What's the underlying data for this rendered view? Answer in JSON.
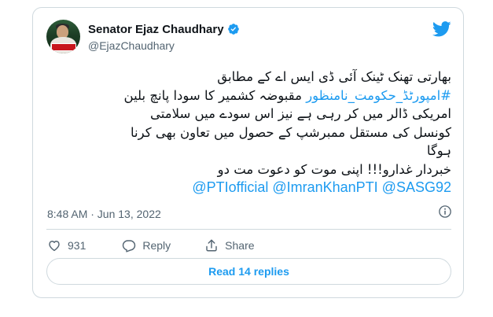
{
  "author": {
    "name": "Senator Ejaz Chaudhary",
    "handle": "@EjazChaudhary"
  },
  "tweet": {
    "lines": [
      "بھارتی تھنک ٹینک آئی ڈی ایس اے کے مطابق",
      "مقبوضہ کشمیر کا سودا پانچ بلین",
      "امریکی ڈالر میں کر رہی ہے نیز اس سودے میں سلامتی",
      "کونسل کی مستقل ممبرشپ کے حصول میں تعاون بھی کرنا",
      "ہوگا",
      "خبردار غدارو!!! اپنی موت کو دعوت مت دو"
    ],
    "hashtag": "#امپورٹڈ_حکومت_نامنظور",
    "mentions": "@PTIofficial @ImranKhanPTI @SASG92"
  },
  "timestamp": "8:48 AM · Jun 13, 2022",
  "actions": {
    "like_count": "931",
    "reply_label": "Reply",
    "share_label": "Share"
  },
  "read_replies_label": "Read 14 replies",
  "colors": {
    "link": "#1d9bf0",
    "text": "#0f1419",
    "muted": "#536471",
    "border": "#cfd9de"
  },
  "icons": [
    "verified-icon",
    "twitter-bird-icon",
    "info-icon",
    "heart-icon",
    "reply-icon",
    "share-icon"
  ]
}
